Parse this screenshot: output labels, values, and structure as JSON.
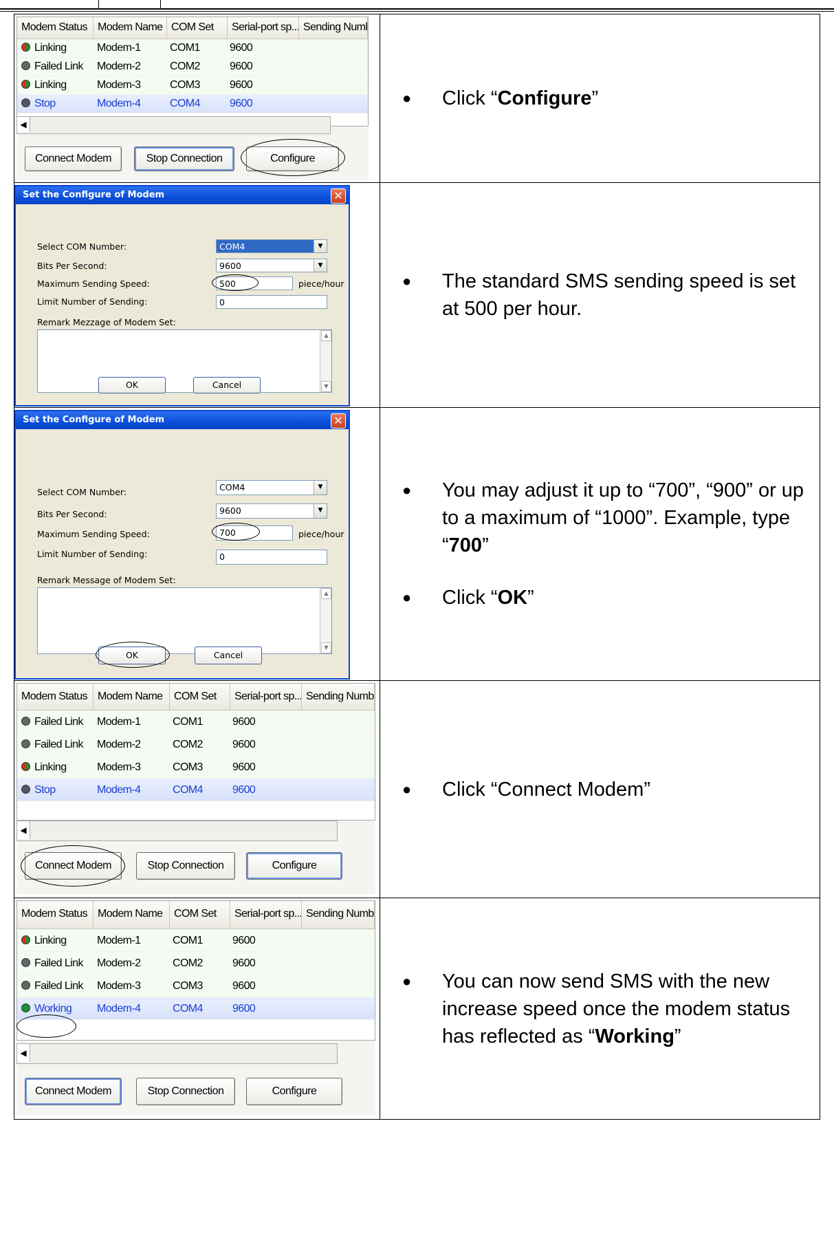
{
  "headers": {
    "status": "Modem Status",
    "name": "Modem Name",
    "com": "COM Set",
    "baud": "Serial-port sp...",
    "sending": "Sending Number"
  },
  "buttons": {
    "connect": "Connect Modem",
    "stop": "Stop Connection",
    "configure": "Configure"
  },
  "dialog": {
    "title": "Set the Configure of Modem",
    "close": "✕",
    "com_label": "Select COM Number:",
    "bits_label": "Bits Per Second:",
    "speed_label": "Maximum Sending Speed:",
    "limit_label": "Limit Number of Sending:",
    "remark_label_1": "Remark Mezzage of Modem Set:",
    "remark_label_2": "Remark Message of Modem Set:",
    "unit": "piece/hour",
    "com_value": "COM4",
    "bits_value": "9600",
    "speed_value_1": "500",
    "speed_value_2": "700",
    "limit_value": "0",
    "ok": "OK",
    "cancel": "Cancel"
  },
  "step1": {
    "rows": [
      {
        "status": "Linking",
        "name": "Modem-1",
        "com": "COM1",
        "baud": "9600"
      },
      {
        "status": "Failed Link",
        "name": "Modem-2",
        "com": "COM2",
        "baud": "9600"
      },
      {
        "status": "Linking",
        "name": "Modem-3",
        "com": "COM3",
        "baud": "9600"
      },
      {
        "status": "Stop",
        "name": "Modem-4",
        "com": "COM4",
        "baud": "9600"
      }
    ],
    "instr_pre": "Click “",
    "instr_bold": "Configure",
    "instr_post": "”"
  },
  "step2": {
    "instr": "The standard SMS sending speed is set at 500 per hour."
  },
  "step3": {
    "instr1_pre": "You may adjust it up to “700”, “900” or up to a maximum of “1000”. Example, type “",
    "instr1_bold": "700",
    "instr1_post": "”",
    "instr2_pre": "Click “",
    "instr2_bold": "OK",
    "instr2_post": "”"
  },
  "step4": {
    "rows": [
      {
        "status": "Failed Link",
        "name": "Modem-1",
        "com": "COM1",
        "baud": "9600"
      },
      {
        "status": "Failed Link",
        "name": "Modem-2",
        "com": "COM2",
        "baud": "9600"
      },
      {
        "status": "Linking",
        "name": "Modem-3",
        "com": "COM3",
        "baud": "9600"
      },
      {
        "status": "Stop",
        "name": "Modem-4",
        "com": "COM4",
        "baud": "9600"
      }
    ],
    "instr": "Click “Connect Modem”"
  },
  "step5": {
    "rows": [
      {
        "status": "Linking",
        "name": "Modem-1",
        "com": "COM1",
        "baud": "9600"
      },
      {
        "status": "Failed Link",
        "name": "Modem-2",
        "com": "COM2",
        "baud": "9600"
      },
      {
        "status": "Failed Link",
        "name": "Modem-3",
        "com": "COM3",
        "baud": "9600"
      },
      {
        "status": "Working",
        "name": "Modem-4",
        "com": "COM4",
        "baud": "9600"
      }
    ],
    "instr_pre": "You can now send SMS with the new increase speed once the modem status has reflected as “",
    "instr_bold": "Working",
    "instr_post": "”"
  }
}
